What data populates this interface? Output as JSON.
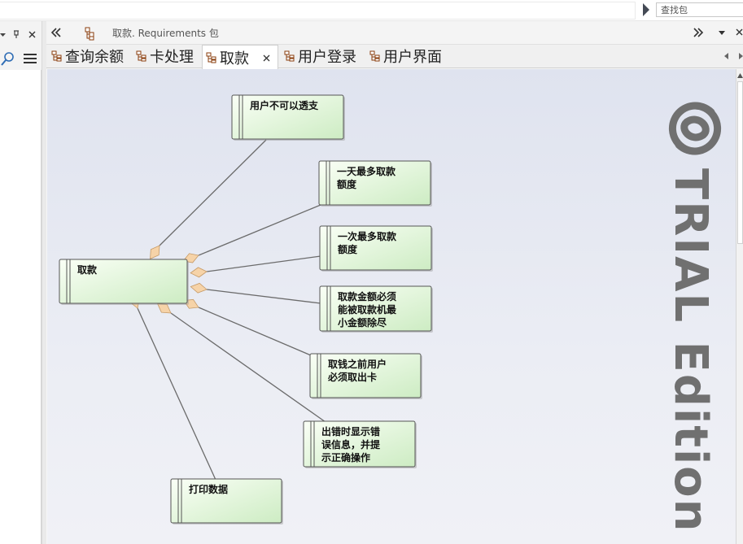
{
  "toolbar": {
    "search_placeholder": "查找包"
  },
  "path": {
    "label": "取款. Requirements 包"
  },
  "tabs": [
    {
      "label": "查询余额",
      "active": false
    },
    {
      "label": "卡处理",
      "active": false
    },
    {
      "label": "取款",
      "active": true
    },
    {
      "label": "用户登录",
      "active": false
    },
    {
      "label": "用户界面",
      "active": false
    }
  ],
  "diagram": {
    "center": {
      "label": "取款"
    },
    "requirements": [
      {
        "id": "r1",
        "lines": [
          "用户不可以透支"
        ]
      },
      {
        "id": "r2",
        "lines": [
          "一天最多取款",
          "额度"
        ]
      },
      {
        "id": "r3",
        "lines": [
          "一次最多取款",
          "额度"
        ]
      },
      {
        "id": "r4",
        "lines": [
          "取款金额必须",
          "能被取款机最",
          "小金额除尽"
        ]
      },
      {
        "id": "r5",
        "lines": [
          "取钱之前用户",
          "必须取出卡"
        ]
      },
      {
        "id": "r6",
        "lines": [
          "出错时显示错",
          "误信息，并提",
          "示正确操作"
        ]
      },
      {
        "id": "r7",
        "lines": [
          "打印数据"
        ]
      }
    ],
    "watermark": "TRIAL Edition"
  },
  "colors": {
    "element_fill_start": "#fafff6",
    "element_fill_end": "#cfeec6",
    "diamond": "#f6d3a8",
    "connector": "#6b6b6b",
    "watermark": "#707070"
  }
}
